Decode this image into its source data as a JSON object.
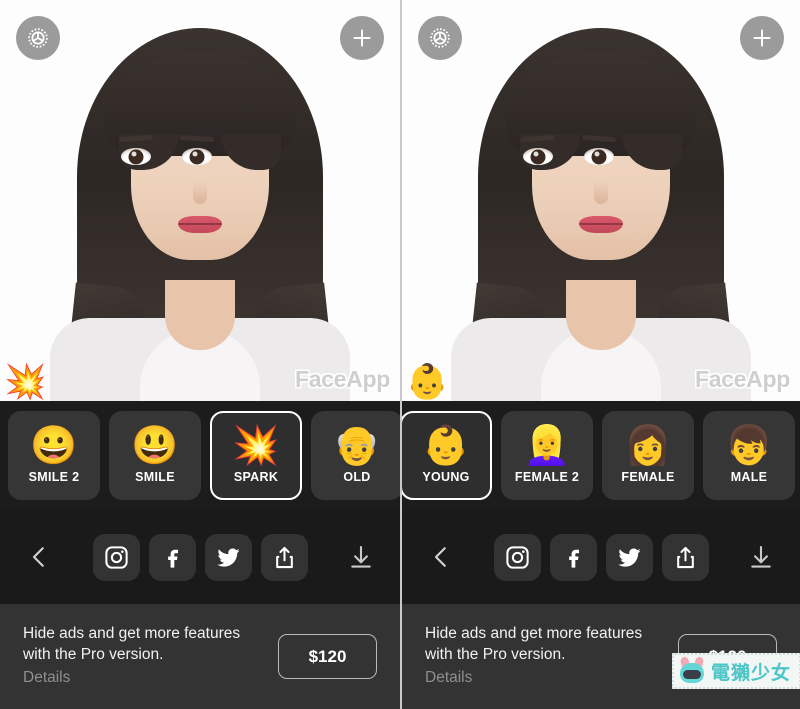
{
  "app": {
    "name": "FaceApp",
    "watermark": "FaceApp"
  },
  "top_controls": {
    "settings_icon": "gear-icon",
    "add_icon": "plus-icon"
  },
  "panels": [
    {
      "id": "left",
      "photo_overlay_emoji": "💥",
      "filters": [
        {
          "label": "SMILE 2",
          "emoji": "😀",
          "selected": false
        },
        {
          "label": "SMILE",
          "emoji": "😃",
          "selected": false
        },
        {
          "label": "SPARK",
          "emoji": "💥",
          "selected": true
        },
        {
          "label": "OLD",
          "emoji": "👴",
          "selected": false
        }
      ]
    },
    {
      "id": "right",
      "photo_overlay_emoji": "👶",
      "filters": [
        {
          "label": "YOUNG",
          "emoji": "👶",
          "selected": true
        },
        {
          "label": "FEMALE 2",
          "emoji": "👱‍♀️",
          "selected": false
        },
        {
          "label": "FEMALE",
          "emoji": "👩",
          "selected": false
        },
        {
          "label": "MALE",
          "emoji": "👦",
          "selected": false
        }
      ]
    }
  ],
  "toolbar": {
    "back_icon": "chevron-left-icon",
    "share_targets": [
      {
        "name": "instagram",
        "icon": "instagram-icon"
      },
      {
        "name": "facebook",
        "icon": "facebook-icon"
      },
      {
        "name": "twitter",
        "icon": "twitter-icon"
      },
      {
        "name": "share",
        "icon": "share-icon"
      }
    ],
    "download_icon": "download-icon"
  },
  "promo": {
    "line1": "Hide ads and get more features",
    "line2": "with the Pro version.",
    "details_label": "Details",
    "price_label": "$120"
  },
  "brand_watermark": {
    "text": "電獺少女",
    "mascot": "otter-mascot-icon"
  },
  "colors": {
    "strip_bg": "#1C1C1C",
    "tile_bg": "#363636",
    "toolbar_bg": "#1A1A1A",
    "promo_bg": "#333333",
    "selected_border": "#FFFFFF",
    "details_text": "#8F8F8F",
    "brand_teal": "#4CC6C6"
  }
}
